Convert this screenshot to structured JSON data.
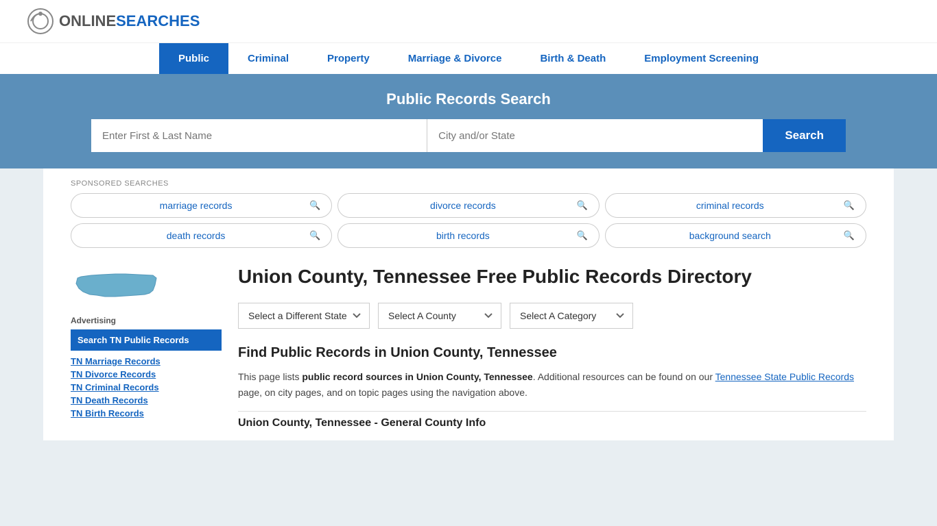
{
  "logo": {
    "online": "ONLINE",
    "searches": "SEARCHES"
  },
  "nav": {
    "items": [
      {
        "label": "Public",
        "active": true
      },
      {
        "label": "Criminal",
        "active": false
      },
      {
        "label": "Property",
        "active": false
      },
      {
        "label": "Marriage & Divorce",
        "active": false
      },
      {
        "label": "Birth & Death",
        "active": false
      },
      {
        "label": "Employment Screening",
        "active": false
      }
    ]
  },
  "search_banner": {
    "title": "Public Records Search",
    "name_placeholder": "Enter First & Last Name",
    "location_placeholder": "City and/or State",
    "button_label": "Search"
  },
  "sponsored": {
    "label": "SPONSORED SEARCHES",
    "items": [
      {
        "text": "marriage records"
      },
      {
        "text": "divorce records"
      },
      {
        "text": "criminal records"
      },
      {
        "text": "death records"
      },
      {
        "text": "birth records"
      },
      {
        "text": "background search"
      }
    ]
  },
  "page": {
    "title": "Union County, Tennessee Free Public Records Directory",
    "dropdowns": {
      "state": "Select a Different State",
      "county": "Select A County",
      "category": "Select A Category"
    },
    "section_heading": "Find Public Records in Union County, Tennessee",
    "description_part1": "This page lists ",
    "description_bold": "public record sources in Union County, Tennessee",
    "description_part2": ". Additional resources can be found on our ",
    "description_link": "Tennessee State Public Records",
    "description_part3": " page, on city pages, and on topic pages using the navigation above.",
    "general_info": "Union County, Tennessee - General County Info"
  },
  "sidebar": {
    "advertising_label": "Advertising",
    "ad_highlight": "Search TN Public Records",
    "links": [
      "TN Marriage Records",
      "TN Divorce Records",
      "TN Criminal Records",
      "TN Death Records",
      "TN Birth Records"
    ]
  }
}
